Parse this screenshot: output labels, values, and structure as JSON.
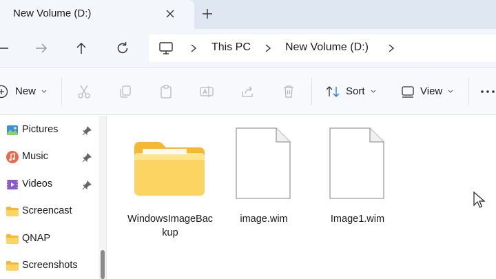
{
  "tab": {
    "title": "New Volume (D:)"
  },
  "breadcrumb": [
    "This PC",
    "New Volume (D:)"
  ],
  "toolbar": {
    "new_label": "New",
    "sort_label": "Sort",
    "view_label": "View"
  },
  "sidebar": {
    "items": [
      {
        "label": "Pictures",
        "icon": "pictures-icon",
        "pinned": true
      },
      {
        "label": "Music",
        "icon": "music-icon",
        "pinned": true
      },
      {
        "label": "Videos",
        "icon": "videos-icon",
        "pinned": true
      },
      {
        "label": "Screencast",
        "icon": "folder-icon",
        "pinned": false
      },
      {
        "label": "QNAP",
        "icon": "folder-icon",
        "pinned": false
      },
      {
        "label": "Screenshots",
        "icon": "folder-icon",
        "pinned": false
      }
    ]
  },
  "files": [
    {
      "name": "WindowsImageBackup",
      "type": "folder"
    },
    {
      "name": "image.wim",
      "type": "file"
    },
    {
      "name": "Image1.wim",
      "type": "file"
    }
  ],
  "colors": {
    "folder": "#f8c94a",
    "folder_light": "#fddf7f",
    "accent": "#1a73e8"
  }
}
